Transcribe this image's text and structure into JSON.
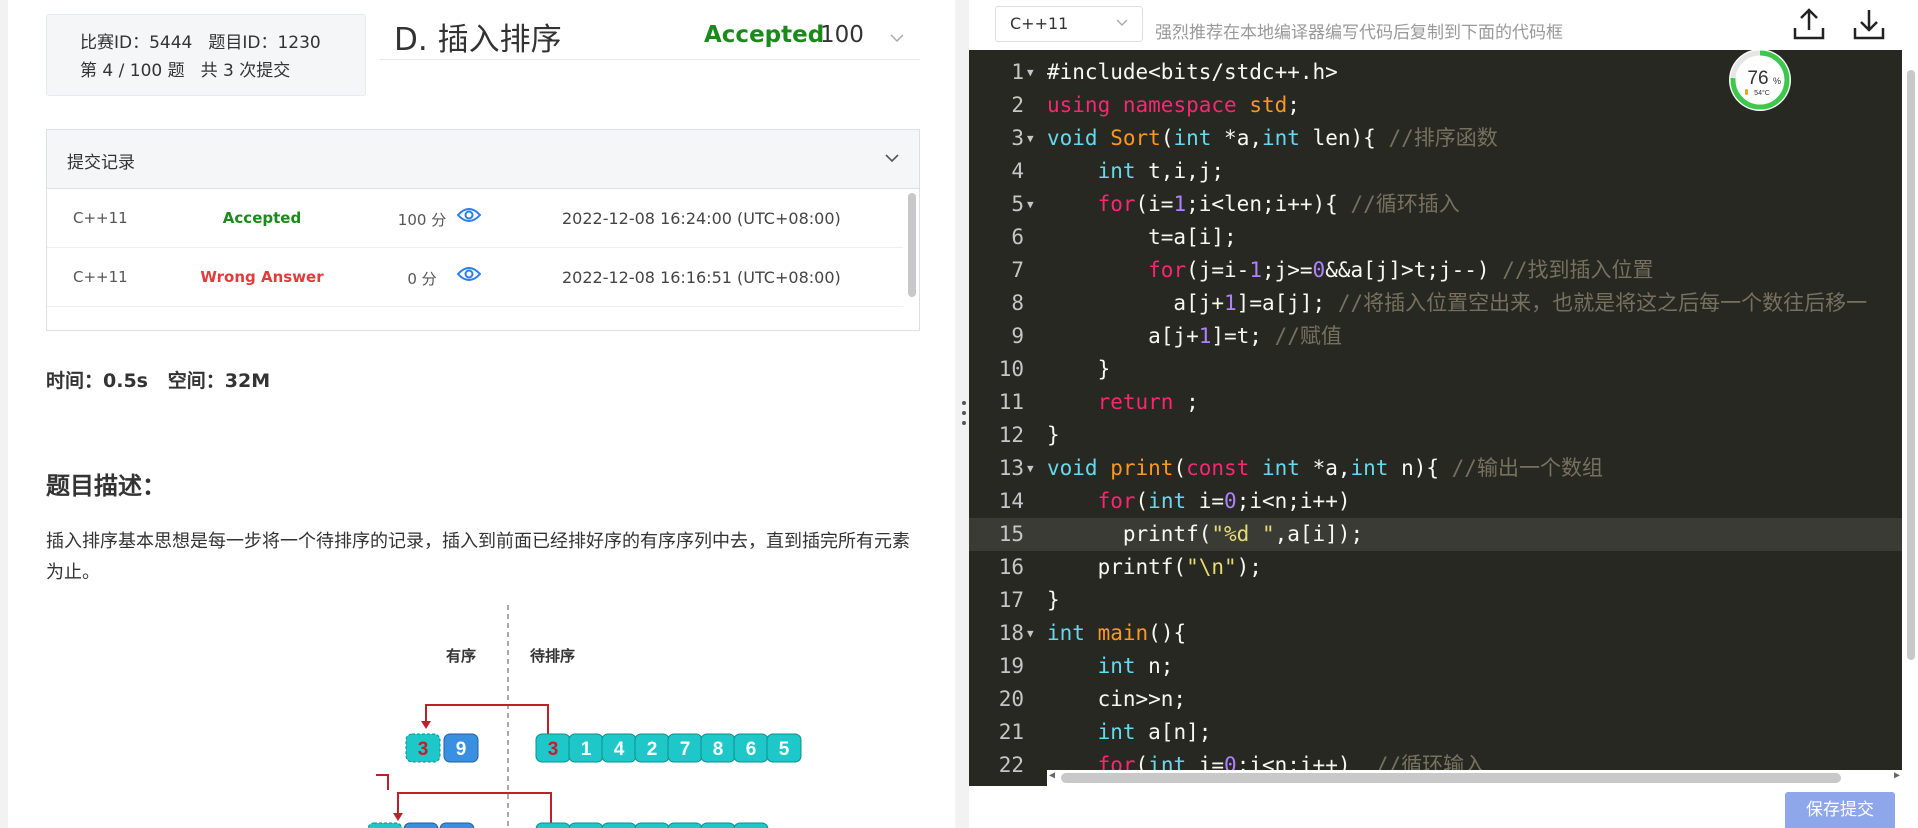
{
  "meta": {
    "contest_id": "比赛ID：5444",
    "problem_id": "题目ID：1230",
    "progress": "第 4 / 100 题",
    "submissions": "共 3 次提交"
  },
  "problem": {
    "title": "D. 插入排序",
    "status": "Accepted",
    "score": "100"
  },
  "records": {
    "title": "提交记录",
    "rows": [
      {
        "lang": "C++11",
        "status": "Accepted",
        "score": "100 分",
        "time": "2022-12-08 16:24:00 (UTC+08:00)"
      },
      {
        "lang": "C++11",
        "status": "Wrong Answer",
        "score": "0 分",
        "time": "2022-12-08 16:16:51 (UTC+08:00)"
      }
    ]
  },
  "limits": "时间：0.5s   空间：32M",
  "description": {
    "heading": "题目描述：",
    "text": "插入排序基本思想是每一步将一个待排序的记录，插入到前面已经排好序的有序序列中去，直到插完所有元素为止。"
  },
  "diagram": {
    "sorted_label": "有序",
    "unsorted_label": "待排序",
    "row1_sorted": [
      "3",
      "9"
    ],
    "row1_unsorted": [
      "3",
      "1",
      "4",
      "2",
      "7",
      "8",
      "6",
      "5"
    ]
  },
  "editor": {
    "language": "C++11",
    "tip": "强烈推荐在本地编译器编写代码后复制到下面的代码框",
    "save_label": "保存提交",
    "cpu_percent": "76",
    "cpu_unit": "%",
    "cpu_temp": "54°C",
    "lines": [
      "1",
      "2",
      "3",
      "4",
      "5",
      "6",
      "7",
      "8",
      "9",
      "10",
      "11",
      "12",
      "13",
      "14",
      "15",
      "16",
      "17",
      "18",
      "19",
      "20",
      "21",
      "22"
    ]
  },
  "colors": {
    "accepted": "#1a8a1a",
    "wrong": "#e03c3c",
    "editor_bg": "#272822",
    "button": "#8ea6ea"
  }
}
